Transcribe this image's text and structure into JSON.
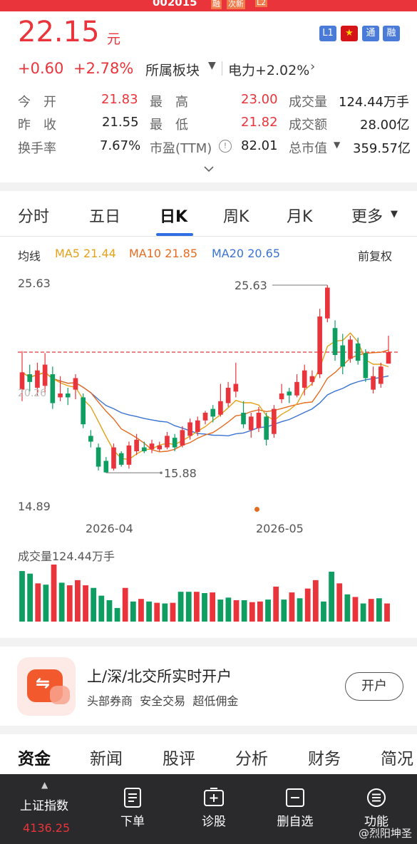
{
  "top_banner": {
    "code": "002015",
    "tags": [
      "融",
      "次新",
      "L2"
    ]
  },
  "quote": {
    "price": "22.15",
    "unit": "元",
    "change": "+0.60",
    "change_pct": "+2.78%",
    "sector_label": "所属板块",
    "sector_value": "电力+2.02%",
    "badges": [
      "L1",
      "通",
      "融"
    ],
    "colors": {
      "up": "#e8343a",
      "down": "#0e9e62",
      "accent": "#2f6ee5"
    }
  },
  "stats": {
    "open_label": "今　开",
    "open": "21.83",
    "high_label": "最　高",
    "high": "23.00",
    "volume_label": "成交量",
    "volume": "124.44万手",
    "prev_label": "昨　收",
    "prev": "21.55",
    "low_label": "最　低",
    "low": "21.82",
    "turnover_label": "成交额",
    "turnover": "28.00亿",
    "rate_label": "换手率",
    "rate": "7.67%",
    "pe_label": "市盈(TTM)",
    "pe": "82.01",
    "mcap_label": "总市值",
    "mcap": "359.57亿"
  },
  "chart_tabs": [
    "分时",
    "五日",
    "日K",
    "周K",
    "月K",
    "更多"
  ],
  "ma_legend": {
    "label": "均线",
    "ma5": "MA5 21.44",
    "ma10": "MA10 21.85",
    "ma20": "MA20 20.65",
    "adjust": "前复权"
  },
  "chart_data": {
    "type": "candlestick",
    "y_top_label": "25.63",
    "y_bottom_label": "14.89",
    "y_mid_label": "20.26",
    "ylim": [
      14.89,
      25.63
    ],
    "x_labels": [
      "2026-04",
      "2026-05"
    ],
    "max_marker": "25.63",
    "min_marker": "15.88",
    "current_price": 22.15,
    "volume_label": "成交量124.44万手",
    "candles": [
      {
        "o": 20.2,
        "c": 21.1,
        "h": 22.2,
        "l": 19.6
      },
      {
        "o": 21.0,
        "c": 20.6,
        "h": 21.5,
        "l": 20.1
      },
      {
        "o": 20.3,
        "c": 21.2,
        "h": 21.6,
        "l": 19.9
      },
      {
        "o": 20.4,
        "c": 21.5,
        "h": 22.1,
        "l": 20.0
      },
      {
        "o": 21.0,
        "c": 19.5,
        "h": 21.4,
        "l": 19.2
      },
      {
        "o": 19.8,
        "c": 20.0,
        "h": 20.9,
        "l": 19.6
      },
      {
        "o": 20.0,
        "c": 19.8,
        "h": 20.3,
        "l": 19.4
      },
      {
        "o": 20.2,
        "c": 20.8,
        "h": 21.0,
        "l": 19.7
      },
      {
        "o": 19.8,
        "c": 18.4,
        "h": 20.0,
        "l": 18.2
      },
      {
        "o": 17.8,
        "c": 17.5,
        "h": 18.1,
        "l": 17.2
      },
      {
        "o": 17.2,
        "c": 16.2,
        "h": 17.4,
        "l": 16.0
      },
      {
        "o": 16.5,
        "c": 15.9,
        "h": 16.7,
        "l": 15.88
      },
      {
        "o": 16.1,
        "c": 17.2,
        "h": 17.4,
        "l": 16.0
      },
      {
        "o": 16.9,
        "c": 16.3,
        "h": 17.0,
        "l": 16.2
      },
      {
        "o": 16.3,
        "c": 17.3,
        "h": 17.5,
        "l": 16.1
      },
      {
        "o": 17.0,
        "c": 17.6,
        "h": 17.9,
        "l": 16.8
      },
      {
        "o": 17.2,
        "c": 17.0,
        "h": 17.5,
        "l": 16.9
      },
      {
        "o": 17.1,
        "c": 17.4,
        "h": 17.6,
        "l": 16.9
      },
      {
        "o": 17.1,
        "c": 17.3,
        "h": 17.5,
        "l": 17.0
      },
      {
        "o": 17.2,
        "c": 17.8,
        "h": 18.0,
        "l": 17.1
      },
      {
        "o": 17.7,
        "c": 17.2,
        "h": 17.9,
        "l": 17.0
      },
      {
        "o": 17.3,
        "c": 18.1,
        "h": 18.3,
        "l": 17.2
      },
      {
        "o": 17.8,
        "c": 18.5,
        "h": 18.7,
        "l": 17.6
      },
      {
        "o": 18.0,
        "c": 18.6,
        "h": 18.8,
        "l": 17.8
      },
      {
        "o": 18.6,
        "c": 19.0,
        "h": 19.1,
        "l": 18.4
      },
      {
        "o": 19.2,
        "c": 18.8,
        "h": 19.4,
        "l": 18.5
      },
      {
        "o": 18.9,
        "c": 19.6,
        "h": 20.5,
        "l": 18.8
      },
      {
        "o": 19.5,
        "c": 20.3,
        "h": 20.6,
        "l": 19.3
      },
      {
        "o": 20.1,
        "c": 20.5,
        "h": 21.6,
        "l": 19.8
      },
      {
        "o": 19.0,
        "c": 18.4,
        "h": 19.6,
        "l": 18.2
      },
      {
        "o": 18.1,
        "c": 18.8,
        "h": 19.0,
        "l": 17.7
      },
      {
        "o": 18.2,
        "c": 19.0,
        "h": 19.3,
        "l": 18.0
      },
      {
        "o": 18.8,
        "c": 17.6,
        "h": 19.0,
        "l": 17.3
      },
      {
        "o": 17.9,
        "c": 19.2,
        "h": 19.4,
        "l": 17.7
      },
      {
        "o": 19.7,
        "c": 20.0,
        "h": 20.5,
        "l": 19.5
      },
      {
        "o": 20.1,
        "c": 19.9,
        "h": 20.3,
        "l": 19.5
      },
      {
        "o": 19.9,
        "c": 20.6,
        "h": 21.0,
        "l": 19.8
      },
      {
        "o": 20.3,
        "c": 21.2,
        "h": 21.5,
        "l": 19.9
      },
      {
        "o": 20.6,
        "c": 20.9,
        "h": 21.2,
        "l": 20.4
      },
      {
        "o": 21.0,
        "c": 24.0,
        "h": 24.4,
        "l": 20.8
      },
      {
        "o": 23.9,
        "c": 25.5,
        "h": 25.63,
        "l": 23.7
      },
      {
        "o": 23.4,
        "c": 22.0,
        "h": 23.8,
        "l": 21.7
      },
      {
        "o": 22.5,
        "c": 21.4,
        "h": 23.1,
        "l": 21.0
      },
      {
        "o": 21.8,
        "c": 22.8,
        "h": 23.0,
        "l": 21.6
      },
      {
        "o": 22.6,
        "c": 21.7,
        "h": 22.9,
        "l": 21.5
      },
      {
        "o": 22.1,
        "c": 20.8,
        "h": 22.3,
        "l": 20.6
      },
      {
        "o": 20.2,
        "c": 20.9,
        "h": 21.4,
        "l": 20.0
      },
      {
        "o": 20.5,
        "c": 21.4,
        "h": 21.6,
        "l": 20.3
      },
      {
        "o": 21.55,
        "c": 22.15,
        "h": 23.0,
        "l": 21.82
      }
    ],
    "volumes": [
      {
        "v": 78,
        "up": false
      },
      {
        "v": 74,
        "up": false
      },
      {
        "v": 59,
        "up": true
      },
      {
        "v": 57,
        "up": false
      },
      {
        "v": 88,
        "up": true
      },
      {
        "v": 60,
        "up": false
      },
      {
        "v": 56,
        "up": true
      },
      {
        "v": 64,
        "up": true
      },
      {
        "v": 56,
        "up": true
      },
      {
        "v": 52,
        "up": false
      },
      {
        "v": 40,
        "up": false
      },
      {
        "v": 33,
        "up": false
      },
      {
        "v": 21,
        "up": false
      },
      {
        "v": 52,
        "up": true
      },
      {
        "v": 31,
        "up": false
      },
      {
        "v": 35,
        "up": true
      },
      {
        "v": 31,
        "up": false
      },
      {
        "v": 29,
        "up": true
      },
      {
        "v": 28,
        "up": false
      },
      {
        "v": 29,
        "up": true
      },
      {
        "v": 46,
        "up": false
      },
      {
        "v": 46,
        "up": false
      },
      {
        "v": 46,
        "up": true
      },
      {
        "v": 44,
        "up": false
      },
      {
        "v": 45,
        "up": true
      },
      {
        "v": 34,
        "up": false
      },
      {
        "v": 37,
        "up": false
      },
      {
        "v": 33,
        "up": true
      },
      {
        "v": 33,
        "up": false
      },
      {
        "v": 30,
        "up": true
      },
      {
        "v": 31,
        "up": true
      },
      {
        "v": 34,
        "up": false
      },
      {
        "v": 54,
        "up": true
      },
      {
        "v": 34,
        "up": false
      },
      {
        "v": 45,
        "up": true
      },
      {
        "v": 36,
        "up": false
      },
      {
        "v": 51,
        "up": true
      },
      {
        "v": 64,
        "up": true
      },
      {
        "v": 31,
        "up": false
      },
      {
        "v": 77,
        "up": false
      },
      {
        "v": 59,
        "up": true
      },
      {
        "v": 42,
        "up": false
      },
      {
        "v": 38,
        "up": true
      },
      {
        "v": 28,
        "up": false
      },
      {
        "v": 35,
        "up": true
      },
      {
        "v": 36,
        "up": false
      },
      {
        "v": 28,
        "up": true
      }
    ]
  },
  "ad": {
    "title": "上/深/北交所实时开户",
    "subtitle": "头部券商  安全交易  超低佣金",
    "button": "开户"
  },
  "section_tabs": [
    "资金",
    "新闻",
    "股评",
    "分析",
    "财务",
    "简况"
  ],
  "bottom_nav": {
    "index_name": "上证指数",
    "index_value": "4136.25",
    "items": [
      "下单",
      "诊股",
      "删自选",
      "功能"
    ],
    "watermark": "@烈阳坤圣"
  }
}
